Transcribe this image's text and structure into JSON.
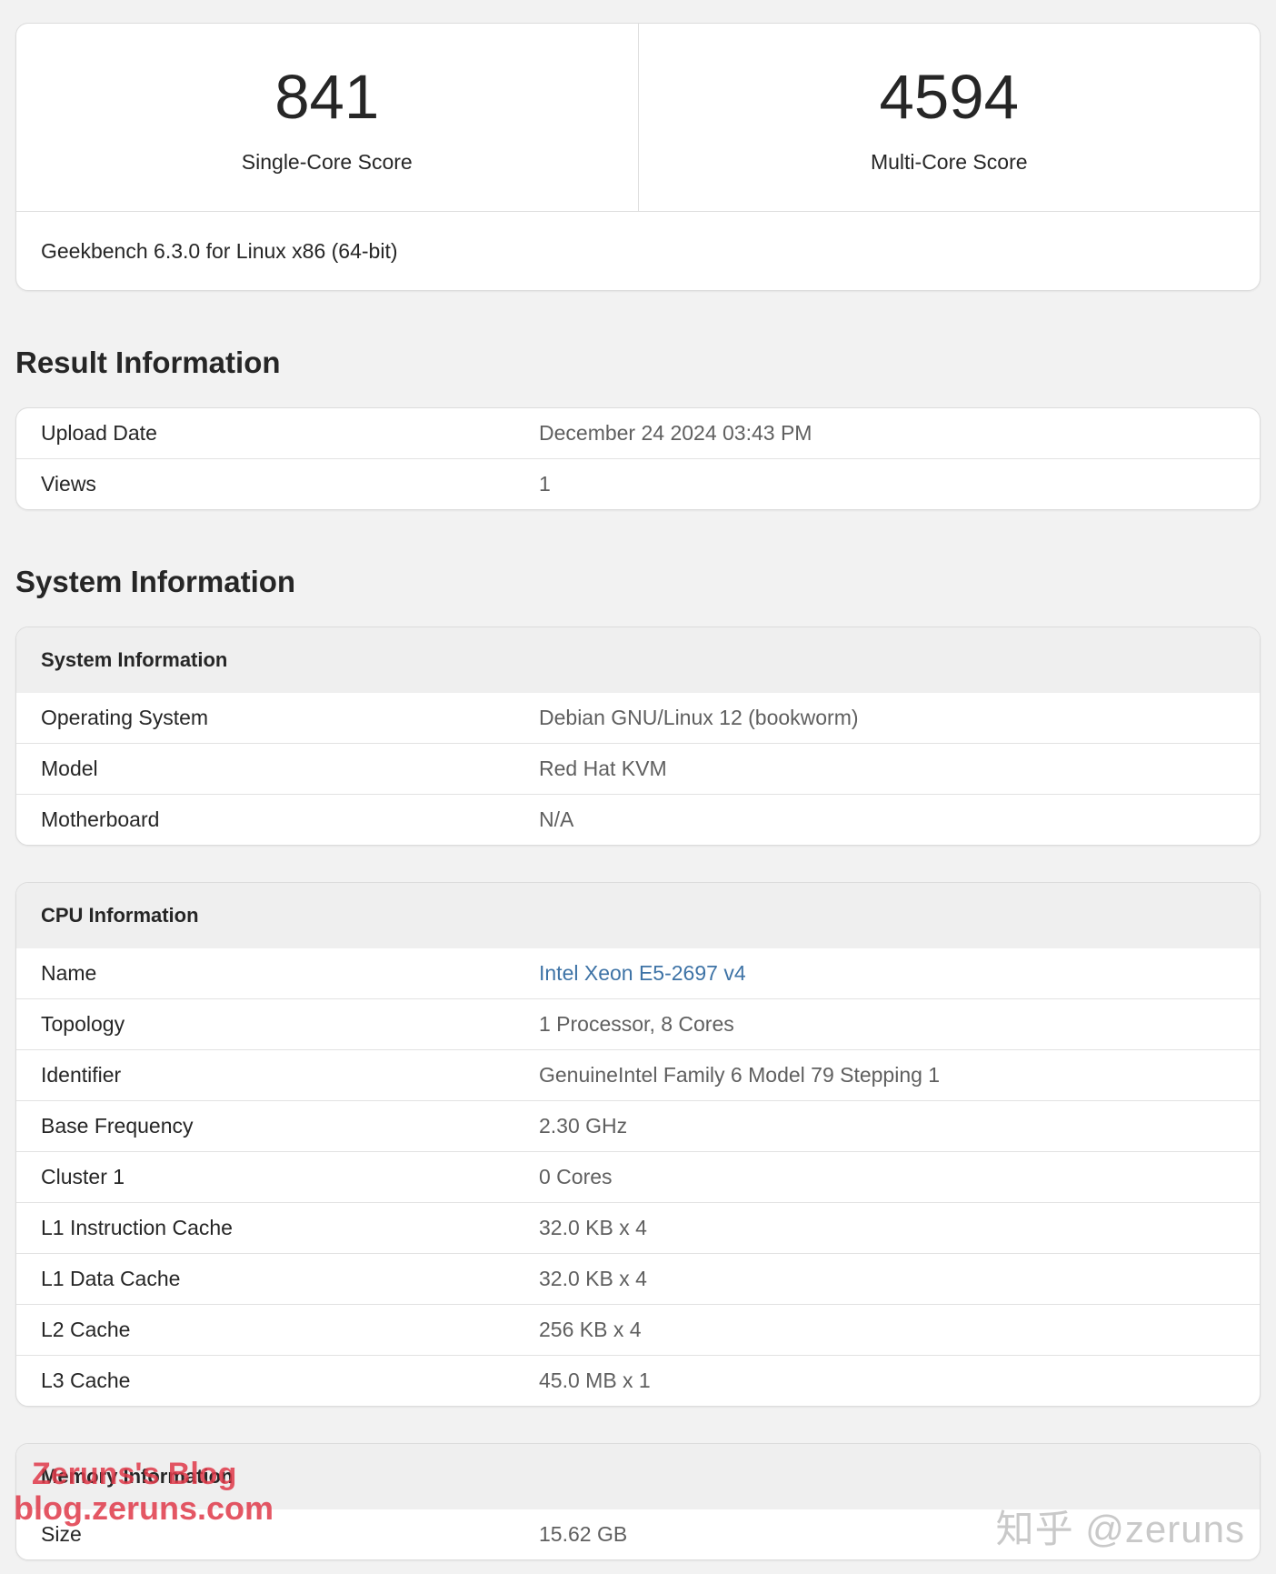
{
  "scores": {
    "single": {
      "value": "841",
      "label": "Single-Core Score"
    },
    "multi": {
      "value": "4594",
      "label": "Multi-Core Score"
    },
    "version": "Geekbench 6.3.0 for Linux x86 (64-bit)"
  },
  "result": {
    "title": "Result Information",
    "rows": [
      {
        "label": "Upload Date",
        "value": "December 24 2024 03:43 PM"
      },
      {
        "label": "Views",
        "value": "1"
      }
    ]
  },
  "system": {
    "title": "System Information",
    "sys_card": {
      "header": "System Information",
      "rows": [
        {
          "label": "Operating System",
          "value": "Debian GNU/Linux 12 (bookworm)"
        },
        {
          "label": "Model",
          "value": "Red Hat KVM"
        },
        {
          "label": "Motherboard",
          "value": "N/A"
        }
      ]
    },
    "cpu_card": {
      "header": "CPU Information",
      "rows": [
        {
          "label": "Name",
          "value": "Intel Xeon E5-2697 v4"
        },
        {
          "label": "Topology",
          "value": "1 Processor, 8 Cores"
        },
        {
          "label": "Identifier",
          "value": "GenuineIntel Family 6 Model 79 Stepping 1"
        },
        {
          "label": "Base Frequency",
          "value": "2.30 GHz"
        },
        {
          "label": "Cluster 1",
          "value": "0 Cores"
        },
        {
          "label": "L1 Instruction Cache",
          "value": "32.0 KB x 4"
        },
        {
          "label": "L1 Data Cache",
          "value": "32.0 KB x 4"
        },
        {
          "label": "L2 Cache",
          "value": "256 KB x 4"
        },
        {
          "label": "L3 Cache",
          "value": "45.0 MB x 1"
        }
      ]
    },
    "mem_card": {
      "header": "Memory Information",
      "rows": [
        {
          "label": "Size",
          "value": "15.62 GB"
        }
      ]
    }
  },
  "watermarks": {
    "blog_name": "Zeruns's Blog",
    "blog_url": "blog.zeruns.com",
    "zhihu": "知乎 @zeruns"
  },
  "colors": {
    "link": "#3e73a6",
    "watermark_red": "#e03a4a"
  }
}
